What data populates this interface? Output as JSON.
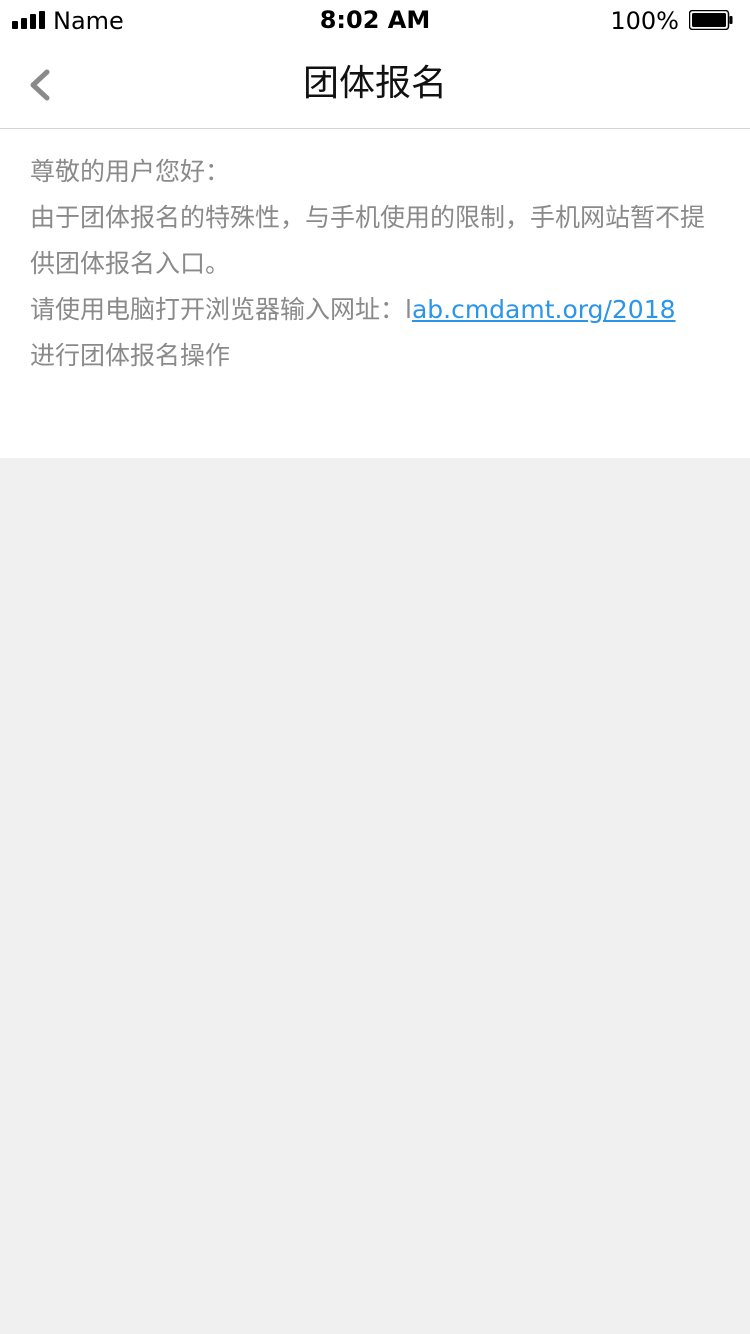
{
  "status_bar": {
    "carrier": "Name",
    "time": "8:02 AM",
    "battery": "100%"
  },
  "nav": {
    "back_icon": "chevron-left-icon",
    "title": "团体报名"
  },
  "notice": {
    "greeting": "尊敬的用户您好：",
    "body": "由于团体报名的特殊性，与手机使用的限制，手机网站暂不提供团体报名入口。",
    "url_prefix": "请使用电脑打开浏览器输入网址：l",
    "url": "ab.cmdamt.org/2018",
    "closing": "进行团体报名操作"
  },
  "colors": {
    "link": "#2b95e9",
    "text_gray": "#8a8a8a",
    "background": "#f0f0f0"
  }
}
